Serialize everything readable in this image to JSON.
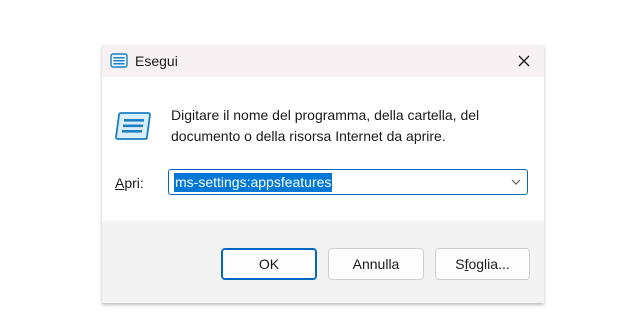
{
  "window": {
    "title": "Esegui",
    "icon": "run-app-icon",
    "close_icon": "close-icon"
  },
  "main": {
    "icon": "run-app-icon",
    "description": "Digitare il nome del programma, della cartella, del documento o della risorsa Internet da aprire.",
    "open_label_mnemonic": "A",
    "open_label_rest": "pri:",
    "open_value": "ms-settings:appsfeatures"
  },
  "buttons": {
    "ok_label": "OK",
    "cancel_label": "Annulla",
    "browse_label_mnemonic": "f",
    "browse_label_before": "S",
    "browse_label_after": "oglia..."
  },
  "colors": {
    "accent": "#0067c0",
    "selection": "#0078d7",
    "titlebar_bg": "#f7f1f3",
    "footer_bg": "#f3f3f3"
  }
}
